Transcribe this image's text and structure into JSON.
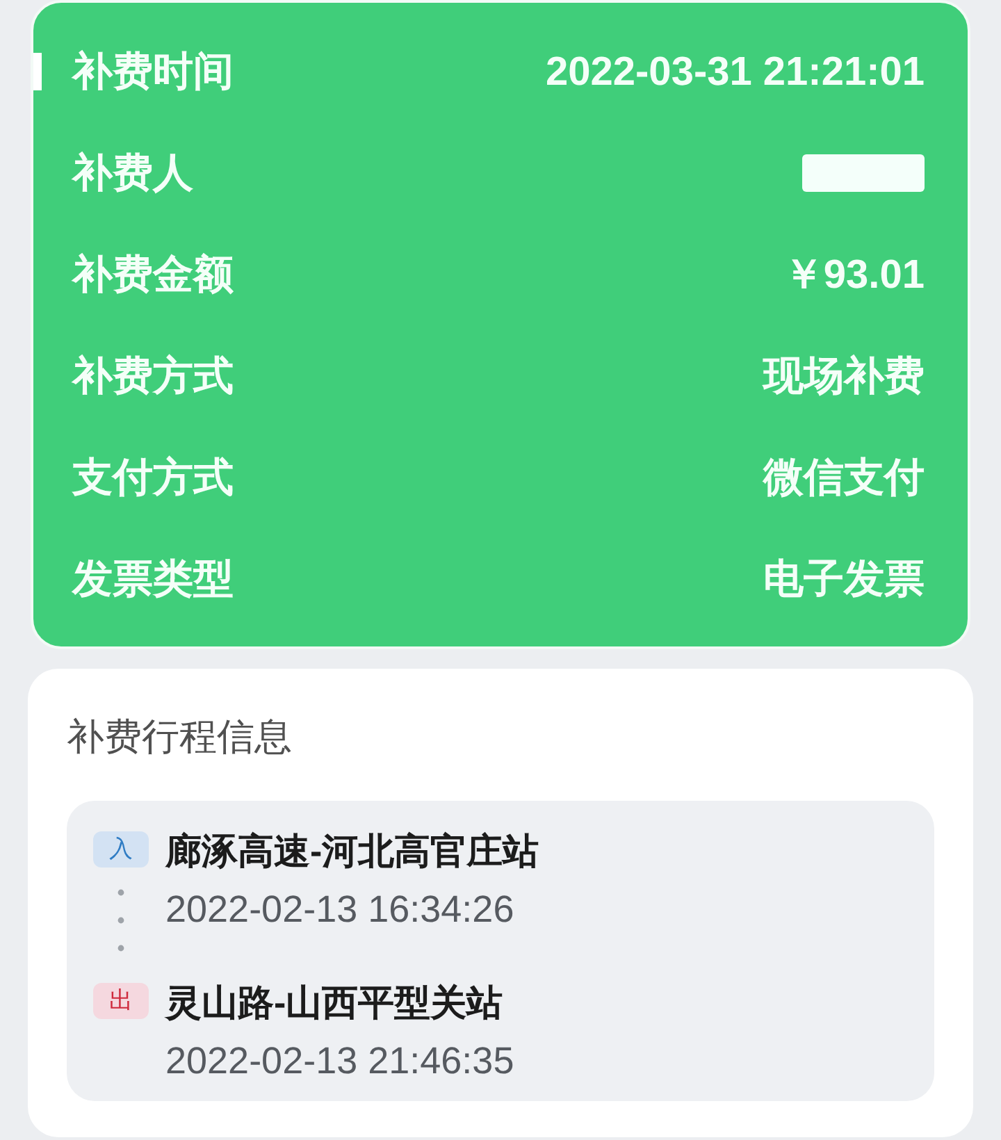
{
  "summary": {
    "rows": [
      {
        "label": "补费时间",
        "kind": "text",
        "value": "2022-03-31 21:21:01",
        "selected": true
      },
      {
        "label": "补费人",
        "kind": "redacted",
        "selected": false
      },
      {
        "label": "补费金额",
        "kind": "text",
        "value": "￥93.01",
        "selected": false
      },
      {
        "label": "补费方式",
        "kind": "text",
        "value": "现场补费",
        "selected": false
      },
      {
        "label": "支付方式",
        "kind": "text",
        "value": "微信支付",
        "selected": false
      },
      {
        "label": "发票类型",
        "kind": "text",
        "value": "电子发票",
        "selected": false
      }
    ]
  },
  "trip": {
    "title": "补费行程信息",
    "stops": [
      {
        "kind": "entry",
        "badge": "入",
        "station": "廊涿高速-河北高官庄站",
        "time": "2022-02-13 16:34:26"
      },
      {
        "kind": "exit",
        "badge": "出",
        "station": "灵山路-山西平型关站",
        "time": "2022-02-13 21:46:35"
      }
    ]
  }
}
